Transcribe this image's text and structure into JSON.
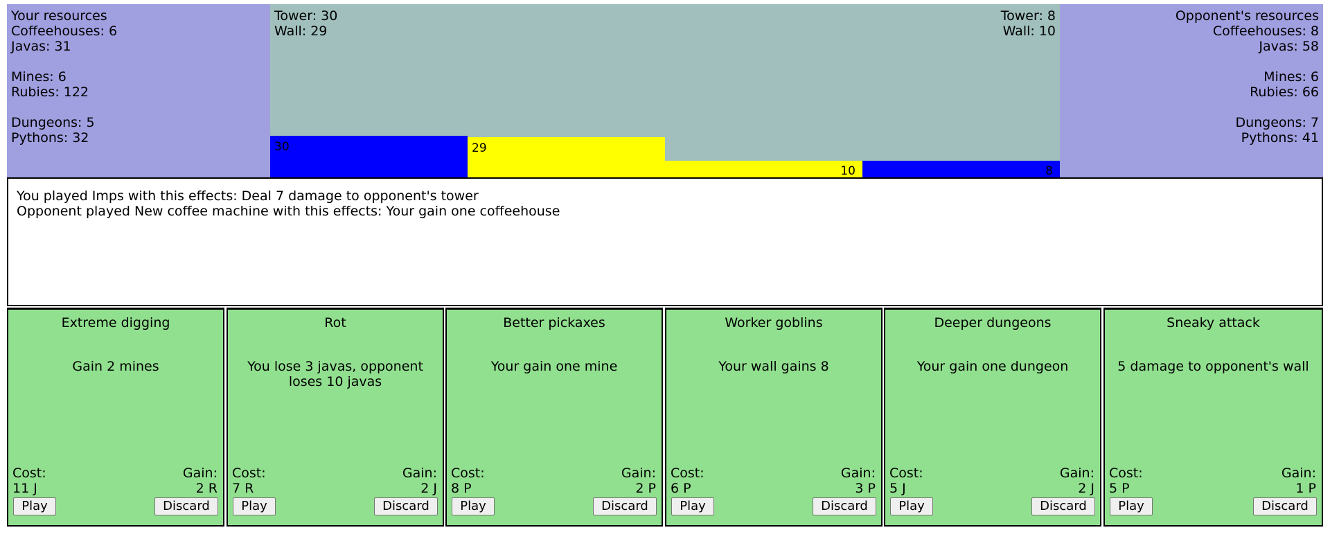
{
  "player": {
    "heading": "Your resources",
    "coffeehouses": "Coffeehouses: 6",
    "javas": "Javas: 31",
    "mines": "Mines: 6",
    "rubies": "Rubies: 122",
    "dungeons": "Dungeons: 5",
    "pythons": "Pythons: 32",
    "tower_label": "Tower: 30",
    "wall_label": "Wall: 29",
    "tower_value": "30",
    "wall_value": "29",
    "tower_height_fraction": 0.245,
    "wall_height_fraction": 0.235
  },
  "opponent": {
    "heading": "Opponent's resources",
    "coffeehouses": "Coffeehouses: 8",
    "javas": "Javas: 58",
    "mines": "Mines: 6",
    "rubies": "Rubies: 66",
    "dungeons": "Dungeons: 7",
    "pythons": "Pythons: 41",
    "tower_label": "Tower: 8",
    "wall_label": "Wall: 10",
    "tower_value": "8",
    "wall_value": "10",
    "tower_height_fraction": 0.1,
    "wall_height_fraction": 0.1
  },
  "log": {
    "line1": "You played Imps with this effects: Deal 7 damage to opponent's tower",
    "line2": "Opponent played New coffee machine with this effects: Your gain one coffeehouse"
  },
  "card_labels": {
    "cost": "Cost:",
    "gain": "Gain:",
    "play": "Play",
    "discard": "Discard"
  },
  "cards": [
    {
      "title": "Extreme digging",
      "description": "Gain 2 mines",
      "cost": "11 J",
      "gain": "2 R"
    },
    {
      "title": "Rot",
      "description": "You lose 3 javas, opponent loses 10 javas",
      "cost": "7 R",
      "gain": "2 J"
    },
    {
      "title": "Better pickaxes",
      "description": "Your gain one mine",
      "cost": "8 P",
      "gain": "2 P"
    },
    {
      "title": "Worker goblins",
      "description": "Your wall gains 8",
      "cost": "6 P",
      "gain": "3 P"
    },
    {
      "title": "Deeper dungeons",
      "description": "Your gain one dungeon",
      "cost": "5 J",
      "gain": "2 J"
    },
    {
      "title": "Sneaky attack",
      "description": "5 damage to opponent's wall",
      "cost": "5 P",
      "gain": "1 P"
    }
  ],
  "colors": {
    "resource_panel": "#a09fe0",
    "field": "#a0bfbd",
    "tower": "#0000ff",
    "wall": "#ffff00",
    "card": "#91e08f"
  }
}
